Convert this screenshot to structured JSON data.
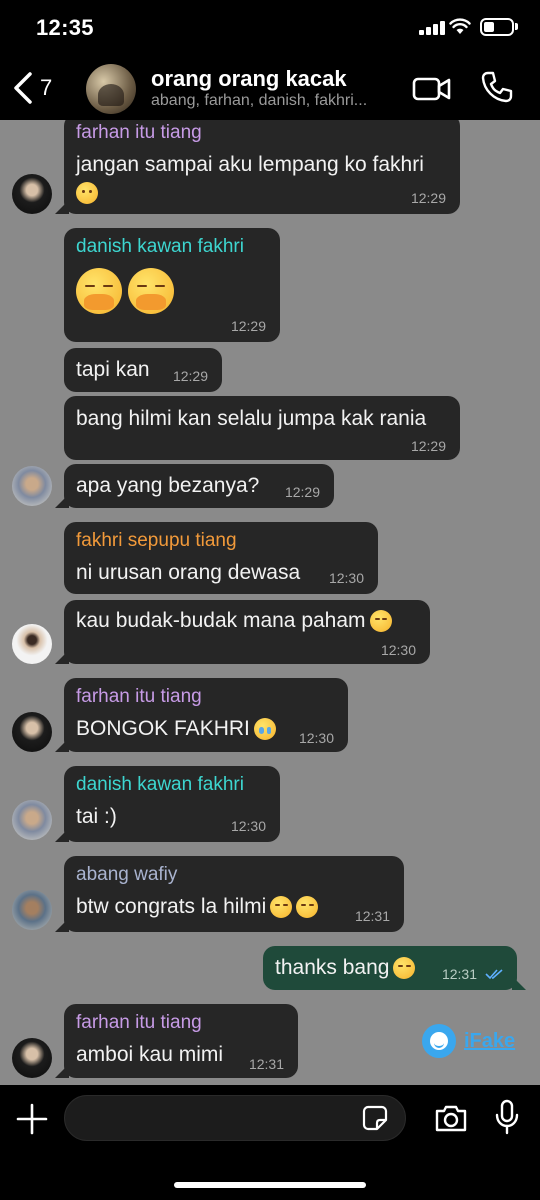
{
  "status_bar": {
    "time": "12:35"
  },
  "header": {
    "back_count": "7",
    "group_name": "orang orang kacak",
    "members": "abang, farhan, danish, fakhri..."
  },
  "colors": {
    "chat_bg": "#8a8a8a",
    "bubble_in": "#262626",
    "bubble_out": "#1f4a3a",
    "farhan": "#c79be6",
    "danish": "#3dd6d0",
    "fakhri": "#f29a3a",
    "wafiy": "#a9b3cf",
    "read_check": "#5fb0ff"
  },
  "messages": [
    {
      "sender": "farhan itu tiang",
      "text": "jangan sampai aku lempang ko fakhri",
      "time": "12:29"
    },
    {
      "sender": "danish kawan fakhri",
      "text": "",
      "time": "12:29"
    },
    {
      "text": "tapi kan",
      "time": "12:29"
    },
    {
      "text": "bang hilmi kan selalu jumpa kak rania",
      "time": "12:29"
    },
    {
      "text": "apa yang bezanya?",
      "time": "12:29"
    },
    {
      "sender": "fakhri sepupu tiang",
      "text": "ni urusan orang dewasa",
      "time": "12:30"
    },
    {
      "text": "kau budak-budak mana paham",
      "time": "12:30"
    },
    {
      "sender": "farhan itu tiang",
      "text": "BONGOK FAKHRI",
      "time": "12:30"
    },
    {
      "sender": "danish kawan fakhri",
      "text": "tai :)",
      "time": "12:30"
    },
    {
      "sender": "abang wafiy",
      "text": "btw congrats la hilmi",
      "time": "12:31"
    },
    {
      "text": "thanks bang",
      "time": "12:31"
    },
    {
      "sender": "farhan itu tiang",
      "text": "amboi kau mimi",
      "time": "12:31"
    }
  ],
  "watermark": {
    "label": "iFake"
  },
  "input": {
    "placeholder": "",
    "value": ""
  },
  "icons": [
    "back-chevron-icon",
    "video-call-icon",
    "phone-icon",
    "plus-icon",
    "sticker-icon",
    "camera-icon",
    "microphone-icon",
    "read-check-icon"
  ]
}
